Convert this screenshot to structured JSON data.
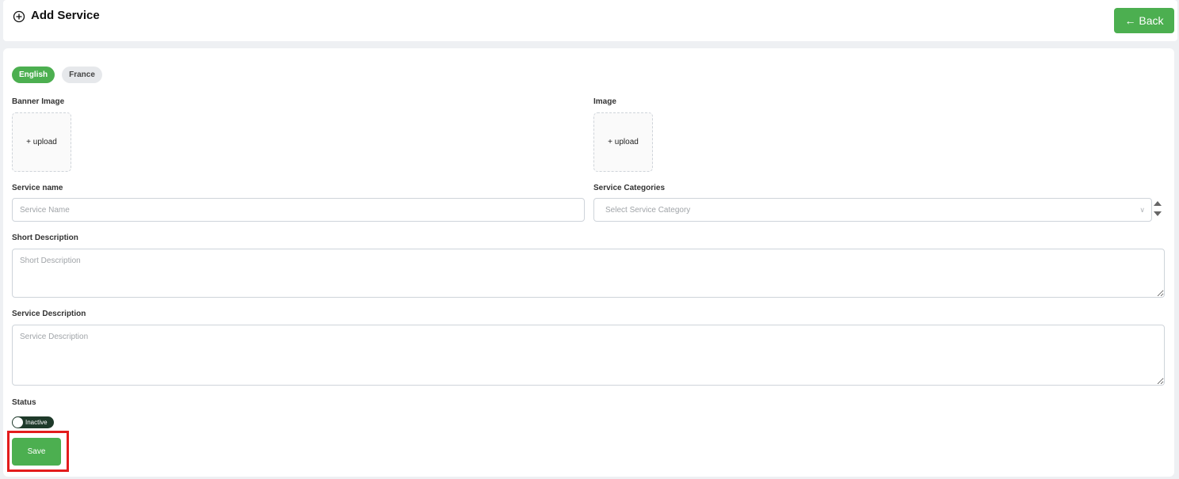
{
  "header": {
    "title": "Add Service",
    "back_label": "← Back",
    "icon": "plus-circle-icon"
  },
  "language_tabs": [
    {
      "label": "English",
      "active": true
    },
    {
      "label": "France",
      "active": false
    }
  ],
  "form": {
    "banner_image_label": "Banner Image",
    "banner_upload_text": "+ upload",
    "image_label": "Image",
    "image_upload_text": "+ upload",
    "service_name_label": "Service name",
    "service_name_placeholder": "Service Name",
    "service_name_value": "",
    "service_categories_label": "Service Categories",
    "service_categories_placeholder": "Select Service Category",
    "short_description_label": "Short Description",
    "short_description_placeholder": "Short Description",
    "service_description_label": "Service Description",
    "service_description_placeholder": "Service Description",
    "status_label": "Status",
    "status_toggle_text": "Inactive",
    "status_on": false,
    "save_label": "Save"
  },
  "colors": {
    "accent": "#4caf50",
    "highlight": "#e31c1c",
    "toggle_off": "#1e3a2a"
  }
}
